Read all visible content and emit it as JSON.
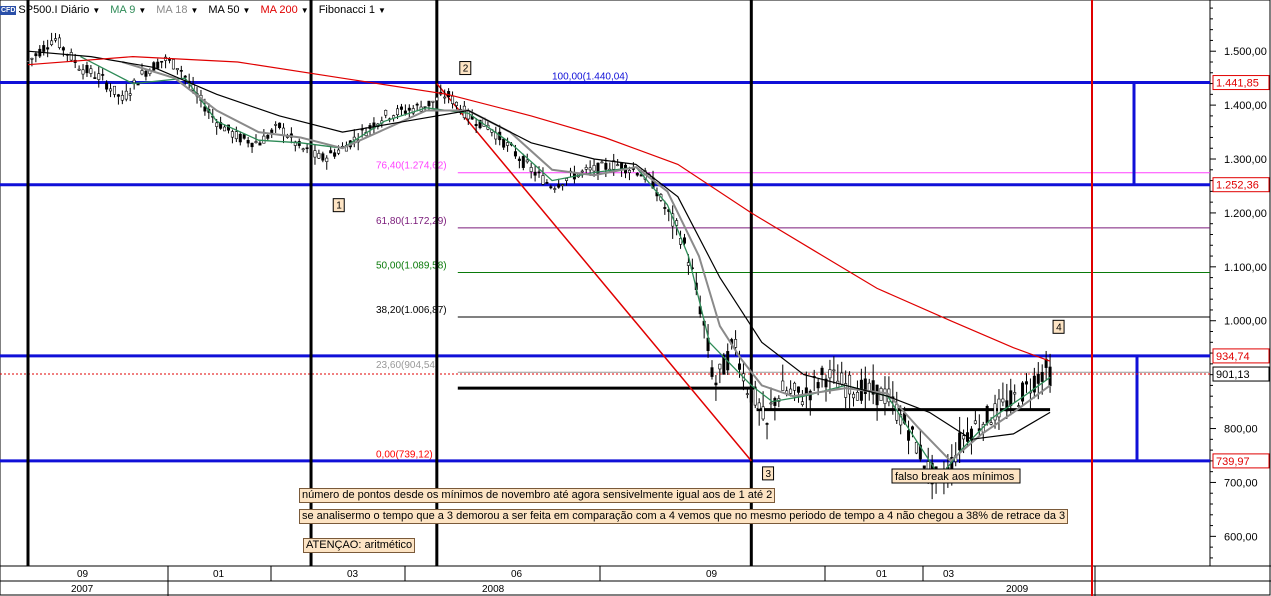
{
  "toolbar": {
    "instrument_badge": "CFD",
    "instrument": "SP500.I Diário",
    "ma9": "MA 9",
    "ma18": "MA 18",
    "ma50": "MA 50",
    "ma200": "MA 200",
    "fib": "Fibonacci 1"
  },
  "colors": {
    "ma9": "#2e8b57",
    "ma18": "#8a8a8a",
    "ma50": "#000000",
    "ma200": "#e00000",
    "blue": "#1010d8",
    "candle": "#000000"
  },
  "chart_data": {
    "type": "candlestick",
    "ylim": [
      545,
      1595
    ],
    "y_ticks": [
      "1.500,00",
      "1.400,00",
      "1.300,00",
      "1.200,00",
      "1.100,00",
      "1.000,00",
      "900,00",
      "800,00",
      "700,00",
      "600,00"
    ],
    "y_tick_values": [
      1500,
      1400,
      1300,
      1200,
      1100,
      1000,
      900,
      800,
      700,
      600
    ],
    "month_labels": [
      {
        "label": "09",
        "t": 2
      },
      {
        "label": "01",
        "t": 36
      },
      {
        "label": "03",
        "t": 60
      },
      {
        "label": "06",
        "t": 101
      },
      {
        "label": "09",
        "t": 135
      },
      {
        "label": "01",
        "t": 165
      },
      {
        "label": "03",
        "t": 177
      }
    ],
    "year_labels": [
      {
        "label": "2007",
        "t": 2
      },
      {
        "label": "2008",
        "t": 92
      },
      {
        "label": "2009",
        "t": 190
      }
    ],
    "close_points": [
      [
        0,
        1480
      ],
      [
        5,
        1525
      ],
      [
        10,
        1470
      ],
      [
        14,
        1450
      ],
      [
        18,
        1410
      ],
      [
        22,
        1460
      ],
      [
        26,
        1485
      ],
      [
        29,
        1470
      ],
      [
        32,
        1420
      ],
      [
        36,
        1370
      ],
      [
        40,
        1340
      ],
      [
        44,
        1330
      ],
      [
        48,
        1360
      ],
      [
        52,
        1320
      ],
      [
        56,
        1300
      ],
      [
        60,
        1320
      ],
      [
        64,
        1350
      ],
      [
        68,
        1380
      ],
      [
        72,
        1390
      ],
      [
        76,
        1400
      ],
      [
        80,
        1420
      ],
      [
        84,
        1380
      ],
      [
        88,
        1360
      ],
      [
        92,
        1320
      ],
      [
        96,
        1280
      ],
      [
        100,
        1250
      ],
      [
        104,
        1270
      ],
      [
        108,
        1280
      ],
      [
        112,
        1290
      ],
      [
        116,
        1280
      ],
      [
        119,
        1260
      ],
      [
        122,
        1200
      ],
      [
        125,
        1150
      ],
      [
        127,
        1080
      ],
      [
        129,
        990
      ],
      [
        131,
        880
      ],
      [
        133,
        920
      ],
      [
        135,
        960
      ],
      [
        137,
        880
      ],
      [
        139,
        850
      ],
      [
        141,
        800
      ],
      [
        142,
        850
      ],
      [
        144,
        870
      ],
      [
        148,
        860
      ],
      [
        152,
        900
      ],
      [
        156,
        880
      ],
      [
        160,
        870
      ],
      [
        164,
        860
      ],
      [
        166,
        830
      ],
      [
        168,
        800
      ],
      [
        170,
        760
      ],
      [
        172,
        720
      ],
      [
        174,
        700
      ],
      [
        176,
        730
      ],
      [
        178,
        780
      ],
      [
        180,
        800
      ],
      [
        183,
        820
      ],
      [
        186,
        840
      ],
      [
        189,
        860
      ],
      [
        192,
        890
      ],
      [
        194,
        910
      ],
      [
        195,
        901
      ]
    ],
    "series": [
      {
        "name": "MA 9",
        "values": [
          [
            10,
            1490
          ],
          [
            20,
            1440
          ],
          [
            30,
            1450
          ],
          [
            36,
            1370
          ],
          [
            44,
            1335
          ],
          [
            52,
            1330
          ],
          [
            60,
            1320
          ],
          [
            68,
            1370
          ],
          [
            76,
            1395
          ],
          [
            84,
            1385
          ],
          [
            92,
            1330
          ],
          [
            100,
            1260
          ],
          [
            108,
            1275
          ],
          [
            116,
            1285
          ],
          [
            122,
            1215
          ],
          [
            126,
            1120
          ],
          [
            130,
            960
          ],
          [
            134,
            920
          ],
          [
            138,
            880
          ],
          [
            142,
            850
          ],
          [
            148,
            860
          ],
          [
            156,
            880
          ],
          [
            164,
            860
          ],
          [
            170,
            770
          ],
          [
            174,
            710
          ],
          [
            178,
            760
          ],
          [
            184,
            820
          ],
          [
            190,
            860
          ],
          [
            195,
            895
          ]
        ]
      },
      {
        "name": "MA 18",
        "values": [
          [
            18,
            1480
          ],
          [
            28,
            1450
          ],
          [
            36,
            1390
          ],
          [
            44,
            1350
          ],
          [
            52,
            1340
          ],
          [
            60,
            1320
          ],
          [
            68,
            1355
          ],
          [
            76,
            1390
          ],
          [
            84,
            1390
          ],
          [
            92,
            1350
          ],
          [
            100,
            1280
          ],
          [
            108,
            1270
          ],
          [
            116,
            1285
          ],
          [
            122,
            1240
          ],
          [
            128,
            1120
          ],
          [
            132,
            990
          ],
          [
            136,
            930
          ],
          [
            140,
            880
          ],
          [
            146,
            860
          ],
          [
            156,
            875
          ],
          [
            164,
            865
          ],
          [
            170,
            800
          ],
          [
            176,
            740
          ],
          [
            182,
            790
          ],
          [
            188,
            830
          ],
          [
            195,
            880
          ]
        ]
      },
      {
        "name": "MA 50",
        "values": [
          [
            0,
            1500
          ],
          [
            12,
            1490
          ],
          [
            24,
            1470
          ],
          [
            36,
            1420
          ],
          [
            48,
            1380
          ],
          [
            60,
            1350
          ],
          [
            72,
            1370
          ],
          [
            84,
            1390
          ],
          [
            96,
            1330
          ],
          [
            108,
            1300
          ],
          [
            116,
            1290
          ],
          [
            124,
            1230
          ],
          [
            132,
            1080
          ],
          [
            140,
            960
          ],
          [
            148,
            900
          ],
          [
            156,
            880
          ],
          [
            164,
            860
          ],
          [
            172,
            830
          ],
          [
            180,
            780
          ],
          [
            188,
            790
          ],
          [
            195,
            830
          ]
        ]
      },
      {
        "name": "MA 200",
        "values": [
          [
            0,
            1475
          ],
          [
            20,
            1490
          ],
          [
            40,
            1480
          ],
          [
            60,
            1450
          ],
          [
            80,
            1420
          ],
          [
            96,
            1380
          ],
          [
            110,
            1340
          ],
          [
            124,
            1290
          ],
          [
            138,
            1200
          ],
          [
            150,
            1130
          ],
          [
            162,
            1060
          ],
          [
            176,
            1000
          ],
          [
            188,
            950
          ],
          [
            195,
            925
          ]
        ]
      }
    ],
    "fib_levels": [
      {
        "label": "100,00(1.440,04)",
        "value": 1440.04,
        "color": "#1010d8"
      },
      {
        "label": "76,40(1.274,62)",
        "value": 1274.62,
        "color": "#ff40ff"
      },
      {
        "label": "61,80(1.172,29)",
        "value": 1172.29,
        "color": "#7a1a7a"
      },
      {
        "label": "50,00(1.089,58)",
        "value": 1089.58,
        "color": "#0a7a0a"
      },
      {
        "label": "38,20(1.006,87)",
        "value": 1006.87,
        "color": "#000000"
      },
      {
        "label": "23,60(904,54)",
        "value": 904.54,
        "color": "#999999"
      },
      {
        "label": "0,00(739,12)",
        "value": 739.12,
        "color": "#ff0000"
      }
    ],
    "blue_levels": [
      {
        "label": "1.441,85",
        "value": 1441.85
      },
      {
        "label": "1.252,36",
        "value": 1252.36
      },
      {
        "label": "934,74",
        "value": 934.74
      },
      {
        "label": "739,97",
        "value": 739.97
      }
    ],
    "current_price": {
      "label": "901,13",
      "value": 901.13
    },
    "points": [
      {
        "label": "1",
        "t": 59,
        "value": 1245
      },
      {
        "label": "2",
        "t": 82,
        "value": 1440
      },
      {
        "label": "3",
        "t": 139,
        "value": 740
      },
      {
        "label": "4",
        "t": 195,
        "value": 934
      }
    ],
    "black_levels": [
      {
        "value": 875,
        "t0": 82,
        "t1": 139
      },
      {
        "value": 835,
        "t0": 139,
        "t1": 195
      }
    ],
    "vertical_lines": [
      {
        "t": 0
      },
      {
        "t": 54
      },
      {
        "t": 78
      },
      {
        "t": 138
      }
    ],
    "today_line": {
      "t": 203
    },
    "annotations": [
      {
        "text": "falso break aos mínimos"
      }
    ]
  },
  "notes": [
    "número de pontos desde os mínimos de novembro até agora sensivelmente igual aos de 1 até 2",
    "se analisermo o tempo que a 3 demorou a ser feita em comparação com a 4 vemos que no mesmo periodo de tempo a 4 não chegou a 38% de retrace da 3",
    "ATENÇAO: aritmético"
  ]
}
